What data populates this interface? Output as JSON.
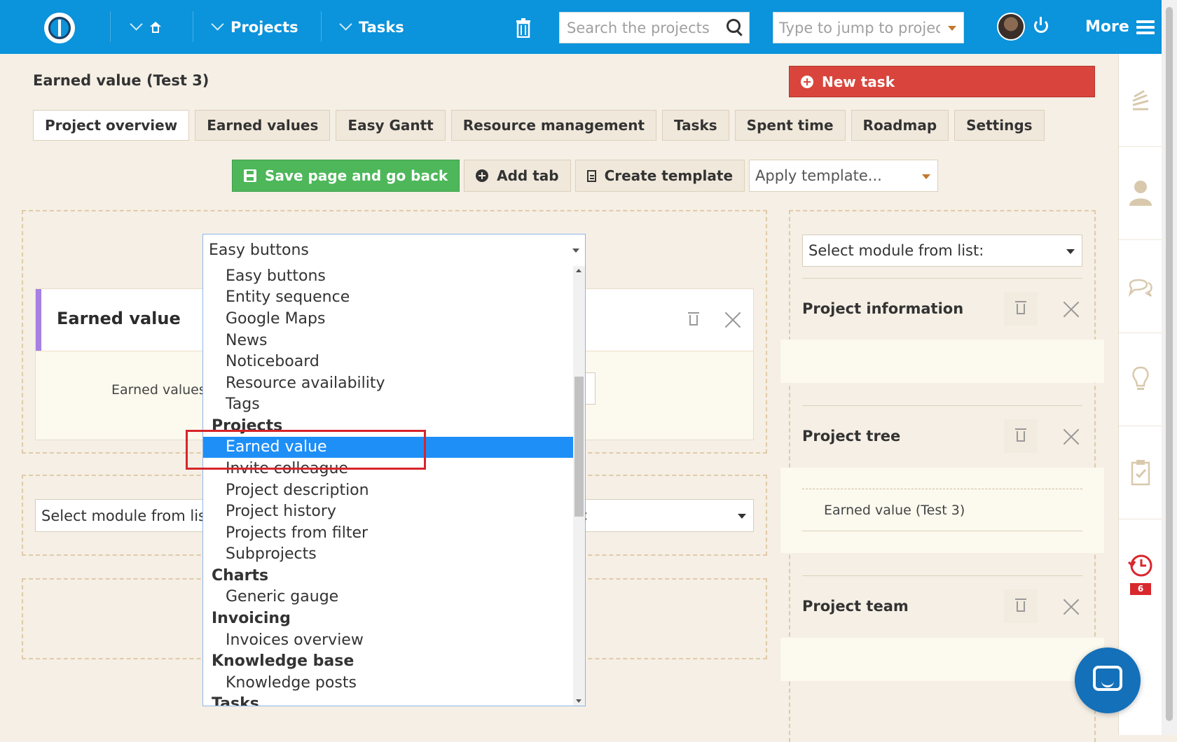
{
  "topbar": {
    "projects_label": "Projects",
    "tasks_label": "Tasks",
    "search_placeholder": "Search the projects",
    "jump_placeholder": "Type to jump to projec",
    "more_label": "More"
  },
  "page": {
    "title": "Earned value (Test 3)",
    "new_task_label": "New task"
  },
  "tabs": [
    {
      "label": "Project overview"
    },
    {
      "label": "Earned values"
    },
    {
      "label": "Easy Gantt"
    },
    {
      "label": "Resource management"
    },
    {
      "label": "Tasks"
    },
    {
      "label": "Spent time"
    },
    {
      "label": "Roadmap"
    },
    {
      "label": "Settings"
    }
  ],
  "actions": {
    "save_label": "Save page and go back",
    "add_tab_label": "Add tab",
    "create_template_label": "Create template",
    "apply_template_value": "Apply template..."
  },
  "left": {
    "module_title": "Earned value",
    "module_body_label": "Earned values",
    "bottom_select_value": "Select module from list"
  },
  "dropdown": {
    "selected_value": "Easy buttons",
    "items": [
      {
        "text": "Easy buttons",
        "group": false
      },
      {
        "text": "Entity sequence",
        "group": false
      },
      {
        "text": "Google Maps",
        "group": false
      },
      {
        "text": "News",
        "group": false
      },
      {
        "text": "Noticeboard",
        "group": false
      },
      {
        "text": "Resource availability",
        "group": false
      },
      {
        "text": "Tags",
        "group": false
      },
      {
        "text": "Projects",
        "group": true
      },
      {
        "text": "Earned value",
        "group": false,
        "selected": true
      },
      {
        "text": "Invite colleague",
        "group": false
      },
      {
        "text": "Project description",
        "group": false
      },
      {
        "text": "Project history",
        "group": false
      },
      {
        "text": "Projects from filter",
        "group": false
      },
      {
        "text": "Subprojects",
        "group": false
      },
      {
        "text": "Charts",
        "group": true
      },
      {
        "text": "Generic gauge",
        "group": false
      },
      {
        "text": "Invoicing",
        "group": true
      },
      {
        "text": "Invoices overview",
        "group": false
      },
      {
        "text": "Knowledge base",
        "group": true
      },
      {
        "text": "Knowledge posts",
        "group": false
      },
      {
        "text": "Tasks",
        "group": true
      }
    ]
  },
  "right": {
    "select_value": "Select module from list:",
    "project_information_title": "Project information",
    "project_tree_title": "Project tree",
    "project_tree_item": "Earned value (Test 3)",
    "project_team_title": "Project team"
  },
  "rail": {
    "badge_count": "6"
  },
  "colors": {
    "topbar": "#0b93db",
    "new_task": "#d9453c",
    "save": "#4db75a",
    "dropdown_selected": "#1e8ff7",
    "highlight": "#d6252b"
  }
}
